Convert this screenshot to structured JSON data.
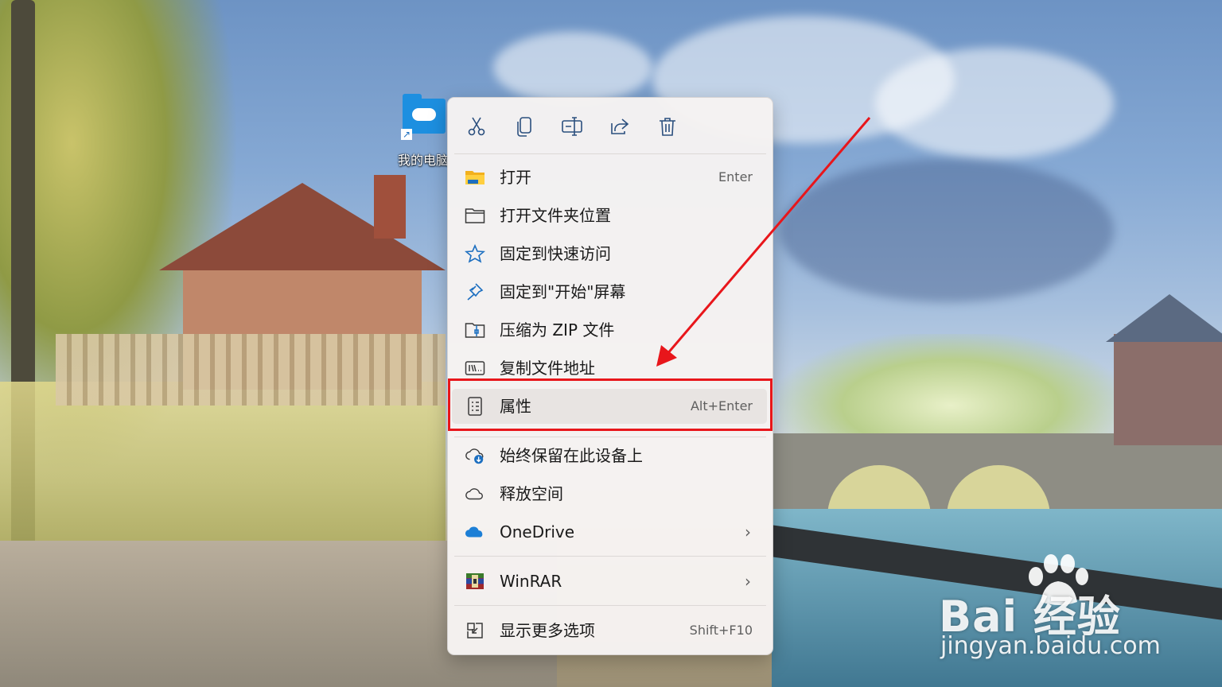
{
  "desktop": {
    "icon_label": "我的电脑"
  },
  "context_menu": {
    "toolbar": [
      {
        "icon": "cut-icon"
      },
      {
        "icon": "copy-icon"
      },
      {
        "icon": "rename-icon"
      },
      {
        "icon": "share-icon"
      },
      {
        "icon": "delete-icon"
      }
    ],
    "items": [
      {
        "label": "打开",
        "shortcut": "Enter",
        "icon": "folder-open-icon"
      },
      {
        "label": "打开文件夹位置",
        "shortcut": "",
        "icon": "folder-icon"
      },
      {
        "label": "固定到快速访问",
        "shortcut": "",
        "icon": "star-icon"
      },
      {
        "label": "固定到\"开始\"屏幕",
        "shortcut": "",
        "icon": "pin-icon"
      },
      {
        "label": "压缩为 ZIP 文件",
        "shortcut": "",
        "icon": "zip-icon"
      },
      {
        "label": "复制文件地址",
        "shortcut": "",
        "icon": "copy-path-icon"
      },
      {
        "label": "属性",
        "shortcut": "Alt+Enter",
        "icon": "properties-icon"
      },
      {
        "label": "始终保留在此设备上",
        "shortcut": "",
        "icon": "cloud-download-icon"
      },
      {
        "label": "释放空间",
        "shortcut": "",
        "icon": "cloud-outline-icon"
      },
      {
        "label": "OneDrive",
        "shortcut": "",
        "icon": "onedrive-icon",
        "submenu": "›"
      },
      {
        "label": "WinRAR",
        "shortcut": "",
        "icon": "winrar-icon",
        "submenu": "›"
      },
      {
        "label": "显示更多选项",
        "shortcut": "Shift+F10",
        "icon": "more-options-icon"
      }
    ]
  },
  "annotation": {
    "highlight_color": "#e8161b"
  },
  "watermark": {
    "brand": "Bai  经验",
    "site": "jingyan.baidu.com"
  }
}
